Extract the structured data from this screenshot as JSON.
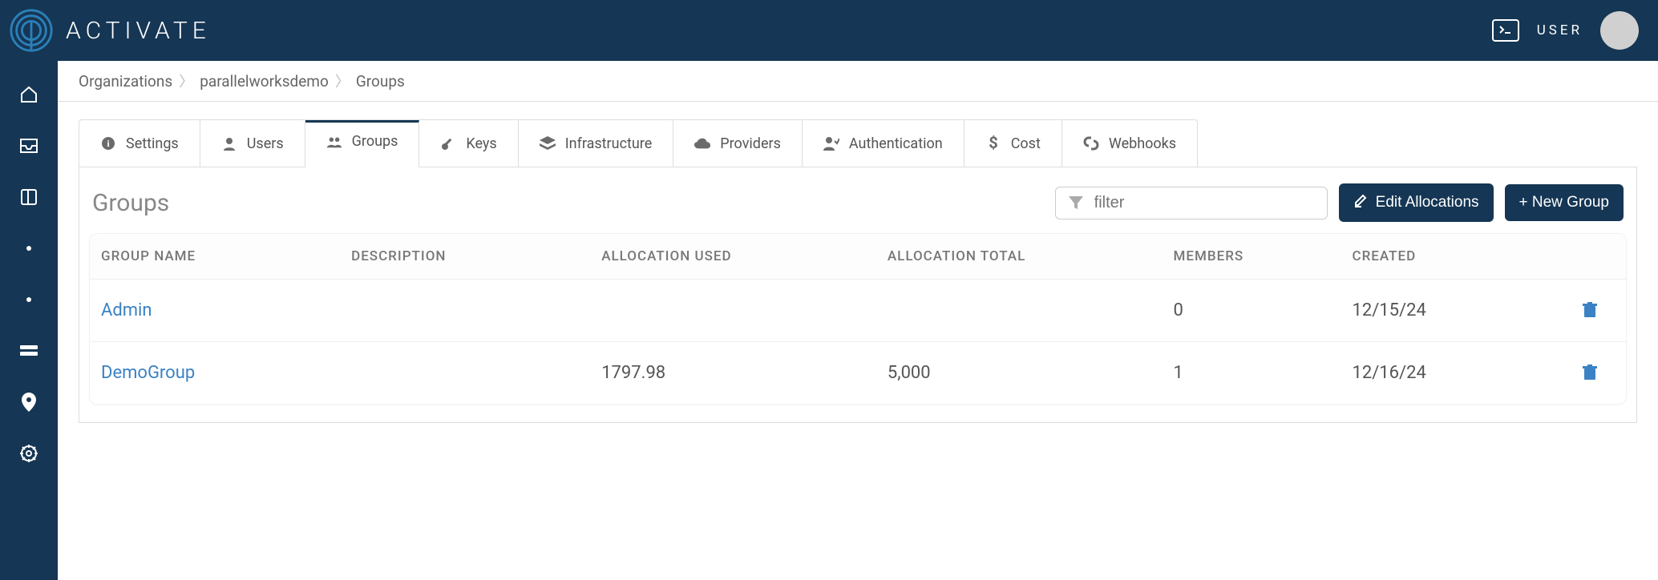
{
  "brand": {
    "name": "ACTIVATE"
  },
  "topbar": {
    "user_label": "USER"
  },
  "breadcrumb": {
    "crumb1": "Organizations",
    "crumb2": "parallelworksdemo",
    "crumb3": "Groups"
  },
  "tabs": {
    "settings": "Settings",
    "users": "Users",
    "groups": "Groups",
    "keys": "Keys",
    "infrastructure": "Infrastructure",
    "providers": "Providers",
    "authentication": "Authentication",
    "cost": "Cost",
    "webhooks": "Webhooks"
  },
  "panel": {
    "title": "Groups",
    "filter_placeholder": "filter",
    "edit_allocations": "Edit Allocations",
    "new_group": "+ New Group"
  },
  "table": {
    "headers": {
      "name": "GROUP NAME",
      "description": "DESCRIPTION",
      "alloc_used": "ALLOCATION USED",
      "alloc_total": "ALLOCATION TOTAL",
      "members": "MEMBERS",
      "created": "CREATED"
    },
    "rows": [
      {
        "name": "Admin",
        "description": "",
        "alloc_used": "",
        "alloc_total": "",
        "members": "0",
        "created": "12/15/24"
      },
      {
        "name": "DemoGroup",
        "description": "",
        "alloc_used": "1797.98",
        "alloc_total": "5,000",
        "members": "1",
        "created": "12/16/24"
      }
    ]
  }
}
